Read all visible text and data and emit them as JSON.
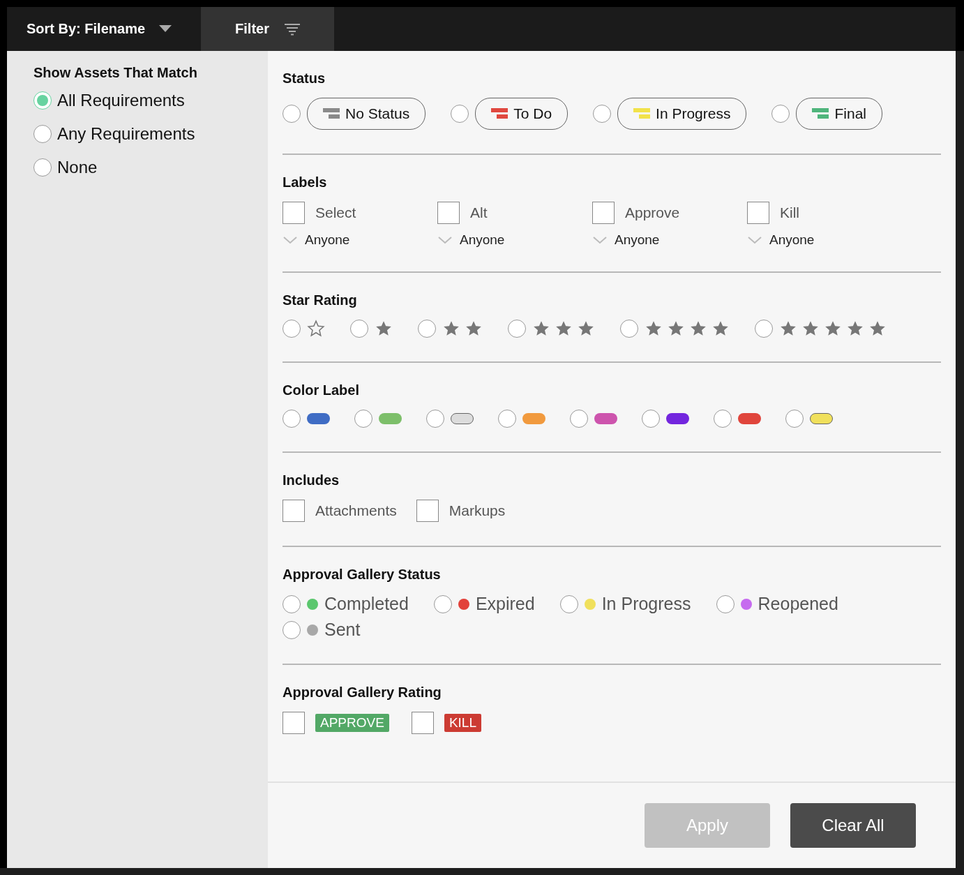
{
  "toolbar": {
    "sort_label": "Sort By: Filename",
    "filter_label": "Filter"
  },
  "match": {
    "title": "Show Assets That Match",
    "options": [
      {
        "label": "All Requirements",
        "selected": true
      },
      {
        "label": "Any Requirements",
        "selected": false
      },
      {
        "label": "None",
        "selected": false
      }
    ]
  },
  "sections": [
    {
      "kind": "status",
      "title": "Status",
      "options": [
        {
          "label": "No Status",
          "color": "#8a8a8a",
          "selected": false
        },
        {
          "label": "To Do",
          "color": "#e0483f",
          "selected": false
        },
        {
          "label": "In Progress",
          "color": "#f1e24a",
          "selected": false
        },
        {
          "label": "Final",
          "color": "#4fb57c",
          "selected": false
        }
      ]
    },
    {
      "kind": "labels",
      "title": "Labels",
      "options": [
        {
          "label": "Select",
          "checked": false,
          "assignee": "Anyone"
        },
        {
          "label": "Alt",
          "checked": false,
          "assignee": "Anyone"
        },
        {
          "label": "Approve",
          "checked": false,
          "assignee": "Anyone"
        },
        {
          "label": "Kill",
          "checked": false,
          "assignee": "Anyone"
        }
      ]
    },
    {
      "kind": "stars",
      "title": "Star Rating",
      "options": [
        {
          "icons": [
            {
              "kind": "outline"
            }
          ],
          "selected": false
        },
        {
          "icons": [
            {
              "kind": "filled"
            }
          ],
          "selected": false
        },
        {
          "icons": [
            {
              "kind": "filled"
            },
            {
              "kind": "filled"
            }
          ],
          "selected": false
        },
        {
          "icons": [
            {
              "kind": "filled"
            },
            {
              "kind": "filled"
            },
            {
              "kind": "filled"
            }
          ],
          "selected": false
        },
        {
          "icons": [
            {
              "kind": "filled"
            },
            {
              "kind": "filled"
            },
            {
              "kind": "filled"
            },
            {
              "kind": "filled"
            }
          ],
          "selected": false
        },
        {
          "icons": [
            {
              "kind": "filled"
            },
            {
              "kind": "filled"
            },
            {
              "kind": "filled"
            },
            {
              "kind": "filled"
            },
            {
              "kind": "filled"
            }
          ],
          "selected": false
        }
      ]
    },
    {
      "kind": "colors",
      "title": "Color Label",
      "options": [
        {
          "color": "#3f6cc4",
          "selected": false
        },
        {
          "color": "#7dbf6a",
          "selected": false
        },
        {
          "color": "#dcdcdc",
          "selected": false
        },
        {
          "color": "#f19a3e",
          "selected": false
        },
        {
          "color": "#cd54ad",
          "selected": false
        },
        {
          "color": "#7326de",
          "selected": false
        },
        {
          "color": "#e0453c",
          "selected": false
        },
        {
          "color": "#f0e05c",
          "selected": false
        }
      ]
    },
    {
      "kind": "includes",
      "title": "Includes",
      "options": [
        {
          "label": "Attachments",
          "checked": false
        },
        {
          "label": "Markups",
          "checked": false
        }
      ]
    },
    {
      "kind": "dots",
      "title": "Approval Gallery Status",
      "options": [
        {
          "label": "Completed",
          "color": "#5bc76e",
          "selected": false
        },
        {
          "label": "Expired",
          "color": "#e2413a",
          "selected": false
        },
        {
          "label": "In Progress",
          "color": "#f0e05c",
          "selected": false
        },
        {
          "label": "Reopened",
          "color": "#c66bef",
          "selected": false
        },
        {
          "label": "Sent",
          "color": "#a8a8a8",
          "selected": false
        }
      ]
    },
    {
      "kind": "badges",
      "title": "Approval Gallery Rating",
      "options": [
        {
          "label": "APPROVE",
          "color": "#52a866",
          "checked": false
        },
        {
          "label": "KILL",
          "color": "#cc3b33",
          "checked": false
        }
      ]
    }
  ],
  "footer": {
    "buttons": [
      {
        "label": "Apply",
        "disabled": true
      },
      {
        "label": "Clear All",
        "disabled": false
      }
    ]
  }
}
